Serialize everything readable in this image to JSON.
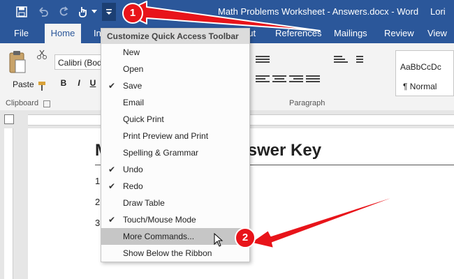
{
  "window": {
    "title": "Math Problems Worksheet - Answers.docx - Word",
    "user": "Lori"
  },
  "tabs": [
    "File",
    "Home",
    "In",
    "out",
    "References",
    "Mailings",
    "Review",
    "View"
  ],
  "ribbon": {
    "paste_label": "Paste",
    "font_name": "Calibri (Bod",
    "bold": "B",
    "italic": "I",
    "underline": "U",
    "clipboard_label": "Clipboard",
    "paragraph_label": "Paragraph",
    "style_sample": "AaBbCcDc",
    "style_name": "¶ Normal"
  },
  "qat_menu": {
    "header": "Customize Quick Access Toolbar",
    "items": [
      {
        "label": "New",
        "checked": false
      },
      {
        "label": "Open",
        "checked": false
      },
      {
        "label": "Save",
        "checked": true
      },
      {
        "label": "Email",
        "checked": false
      },
      {
        "label": "Quick Print",
        "checked": false
      },
      {
        "label": "Print Preview and Print",
        "checked": false
      },
      {
        "label": "Spelling & Grammar",
        "checked": false
      },
      {
        "label": "Undo",
        "checked": true
      },
      {
        "label": "Redo",
        "checked": true
      },
      {
        "label": "Draw Table",
        "checked": false
      },
      {
        "label": "Touch/Mouse Mode",
        "checked": true
      },
      {
        "label": "More Commands...",
        "checked": false,
        "highlighted": true
      },
      {
        "label": "Show Below the Ribbon",
        "checked": false
      }
    ],
    "check_glyph": "✔"
  },
  "document": {
    "title_start": "M",
    "title_end": "nswer Key",
    "lines": [
      "1",
      "2",
      "3"
    ]
  },
  "callouts": {
    "step1": "1",
    "step2": "2"
  },
  "colors": {
    "word_blue": "#2b579a",
    "callout_red": "#e8141a"
  },
  "icons": {
    "save": "save-icon",
    "undo": "undo-icon",
    "redo": "redo-icon",
    "touch": "touch-mode-icon",
    "customize": "customize-qat-icon",
    "paste": "paste-icon",
    "cut": "cut-icon",
    "format_painter": "format-painter-icon",
    "cursor": "mouse-cursor-icon"
  }
}
